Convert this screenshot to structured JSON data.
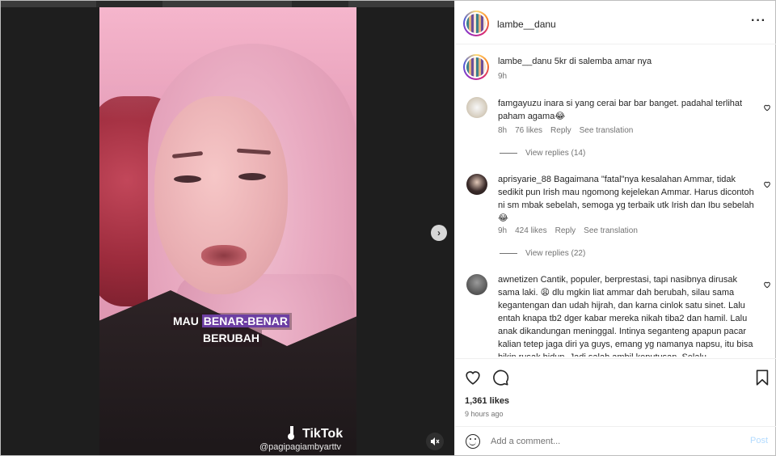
{
  "post": {
    "author": "lambe__danu",
    "caption_user": "lambe__danu",
    "caption_text": "5kr di salemba amar nya",
    "caption_time": "9h",
    "likes": "1,361 likes",
    "time_ago": "9 hours ago"
  },
  "video": {
    "subtitle_line1_pre": "MAU ",
    "subtitle_line1_hl": "BENAR-BENAR",
    "subtitle_line2": "BERUBAH",
    "watermark": "TikTok",
    "handle": "@pagipagiambyarttv",
    "carousel_count": 3,
    "carousel_active": 0
  },
  "comments": [
    {
      "user": "famgayuzu",
      "text": "inara si yang cerai bar bar banget. padahal terlihat paham agama😂",
      "time": "8h",
      "likes": "76 likes",
      "reply": "Reply",
      "translate": "See translation",
      "view_replies": "View replies (14)"
    },
    {
      "user": "aprisyarie_88",
      "text": "Bagaimana \"fatal\"nya kesalahan Ammar, tidak sedikit pun Irish mau ngomong kejelekan Ammar. Harus dicontoh ni sm mbak sebelah, semoga yg terbaik utk Irish dan Ibu sebelah😂",
      "time": "9h",
      "likes": "424 likes",
      "reply": "Reply",
      "translate": "See translation",
      "view_replies": "View replies (22)"
    },
    {
      "user": "awnetizen",
      "text": "Cantik, populer, berprestasi, tapi nasibnya dirusak sama laki. 😩 dlu mgkin liat ammar dah berubah, silau sama kegantengan dan udah hijrah, dan karna cinlok satu sinet. Lalu entah knapa tb2 dger kabar mereka nikah tiba2 dan hamil. Lalu anak dikandungan meninggal. Intinya seganteng apapun pacar kalian tetep jaga diri ya guys, emang yg namanya napsu, itu bisa bikin rusak hidup. Jadi salah ambil keputusan. Selalu"
    }
  ],
  "composer": {
    "placeholder": "Add a comment...",
    "post_label": "Post"
  },
  "icons": {
    "more": "more-horizontal-icon",
    "heart": "heart-icon",
    "comment": "comment-icon",
    "bookmark": "bookmark-icon",
    "emoji": "emoji-icon",
    "next": "chevron-right-icon",
    "mute": "muted-speaker-icon"
  },
  "colors": {
    "text": "#262626",
    "secondary": "#737373",
    "post_disabled": "#b3dbff",
    "subtitle_highlight": "#6d3fa3"
  }
}
